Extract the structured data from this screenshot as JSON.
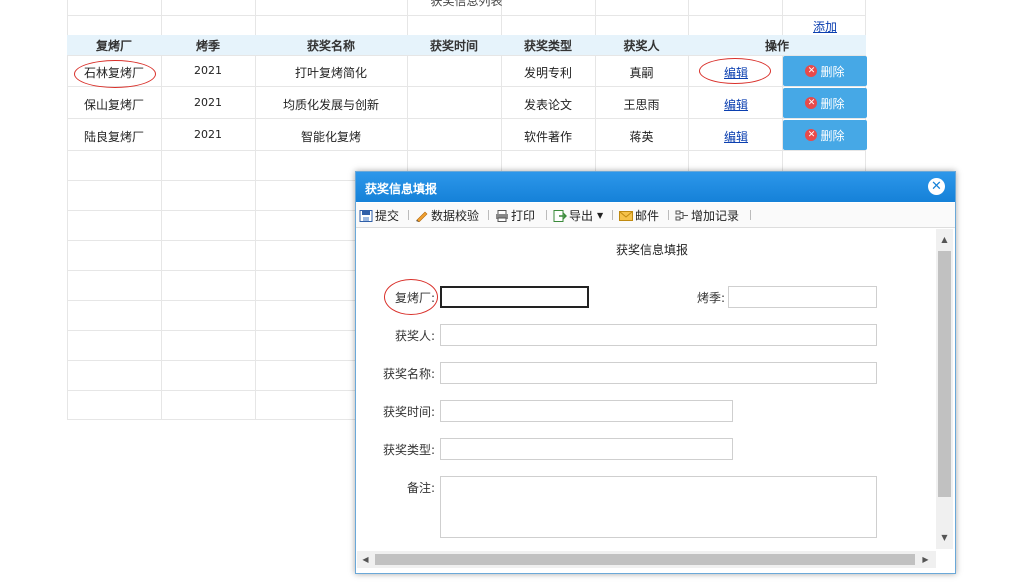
{
  "list": {
    "title": "获奖信息列表",
    "add_label": "添加",
    "columns": [
      "复烤厂",
      "烤季",
      "获奖名称",
      "获奖时间",
      "获奖类型",
      "获奖人",
      "操作"
    ],
    "rows": [
      {
        "factory": "石林复烤厂",
        "season": "2021",
        "award_name": "打叶复烤简化",
        "award_time": "",
        "award_type": "发明专利",
        "winner": "真嗣",
        "edit": "编辑",
        "delete": "删除"
      },
      {
        "factory": "保山复烤厂",
        "season": "2021",
        "award_name": "均质化发展与创新",
        "award_time": "",
        "award_type": "发表论文",
        "winner": "王思雨",
        "edit": "编辑",
        "delete": "删除"
      },
      {
        "factory": "陆良复烤厂",
        "season": "2021",
        "award_name": "智能化复烤",
        "award_time": "",
        "award_type": "软件著作",
        "winner": "蒋英",
        "edit": "编辑",
        "delete": "删除"
      }
    ]
  },
  "dialog": {
    "title": "获奖信息填报",
    "toolbar": {
      "submit": "提交",
      "validate": "数据校验",
      "print": "打印",
      "export": "导出",
      "mail": "邮件",
      "add_record": "增加记录"
    },
    "form": {
      "heading": "获奖信息填报",
      "factory_label": "复烤厂:",
      "factory_value": "",
      "season_label": "烤季:",
      "season_value": "",
      "winner_label": "获奖人:",
      "winner_value": "",
      "award_name_label": "获奖名称:",
      "award_name_value": "",
      "award_time_label": "获奖时间:",
      "award_time_value": "",
      "award_type_label": "获奖类型:",
      "award_type_value": "",
      "remark_label": "备注:",
      "remark_value": ""
    }
  },
  "colors": {
    "header_bg": "#e6f3fb",
    "delete_button": "#46a8e6",
    "dialog_title_bar": "#1581d8",
    "highlight_circle": "#d9302a"
  }
}
